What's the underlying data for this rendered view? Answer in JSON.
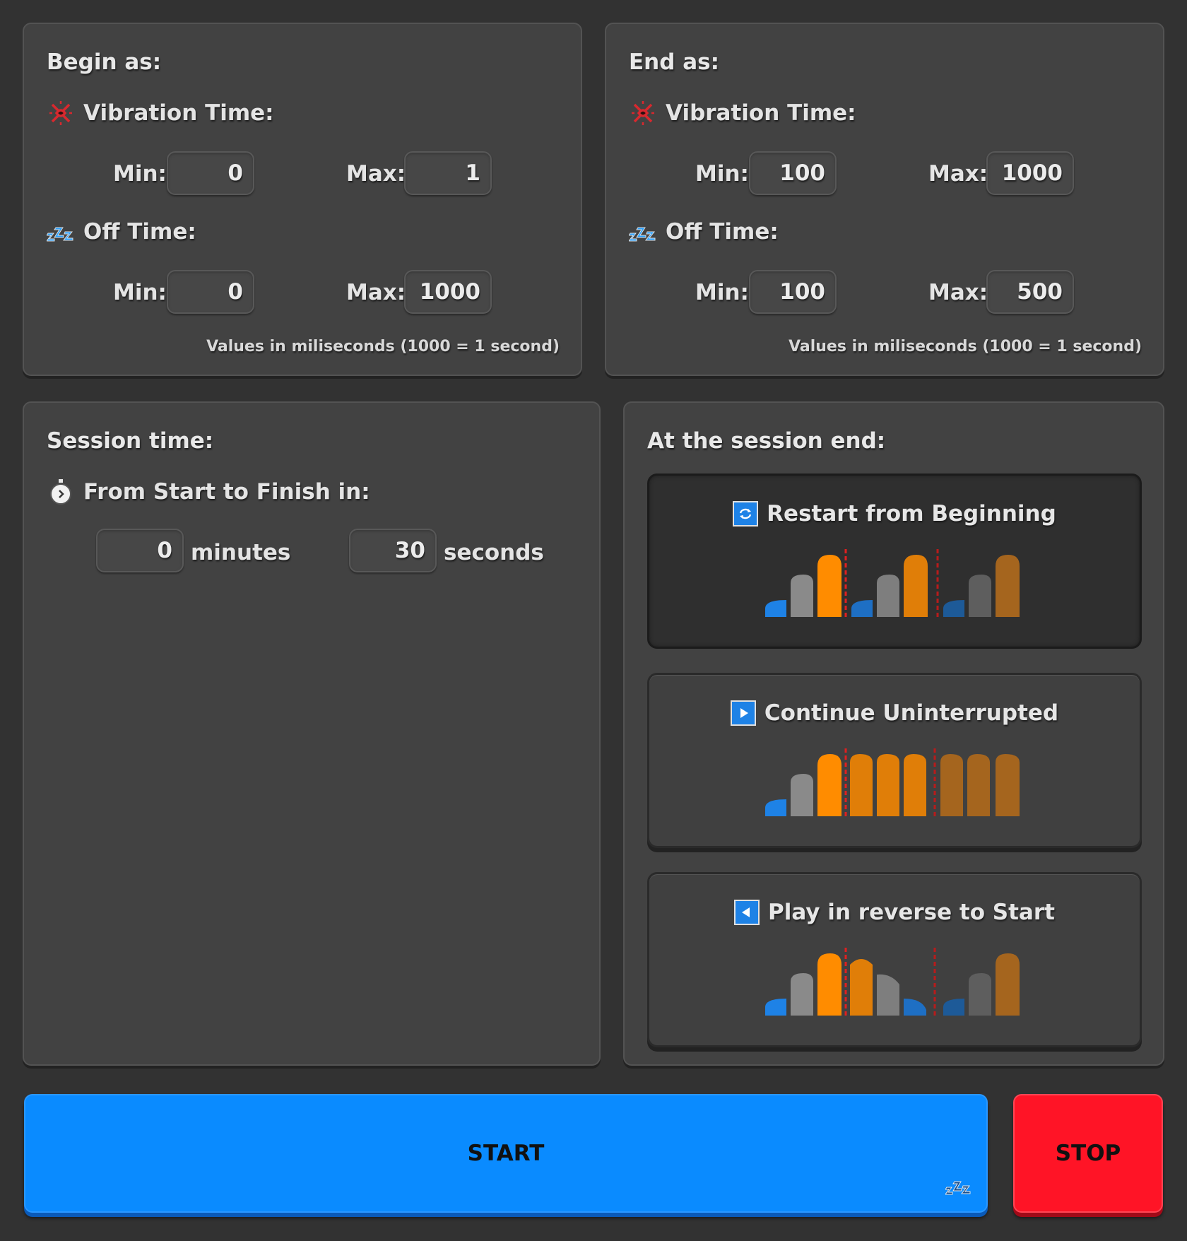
{
  "begin": {
    "title": "Begin as:",
    "vibration_label": "Vibration Time:",
    "off_label": "Off Time:",
    "min_label": "Min:",
    "max_label": "Max:",
    "vibration_min": "0",
    "vibration_max": "1",
    "off_min": "0",
    "off_max": "1000",
    "note": "Values in miliseconds (1000 = 1 second)"
  },
  "end": {
    "title": "End as:",
    "vibration_label": "Vibration Time:",
    "off_label": "Off Time:",
    "min_label": "Min:",
    "max_label": "Max:",
    "vibration_min": "100",
    "vibration_max": "1000",
    "off_min": "100",
    "off_max": "500",
    "note": "Values in miliseconds (1000 = 1 second)"
  },
  "session": {
    "title": "Session time:",
    "subtitle": "From Start to Finish in:",
    "minutes_value": "0",
    "minutes_label": "minutes",
    "seconds_value": "30",
    "seconds_label": "seconds"
  },
  "session_end": {
    "title": "At the session end:",
    "options": [
      {
        "label": "Restart from Beginning",
        "icon": "repeat-icon",
        "selected": true
      },
      {
        "label": "Continue Uninterrupted",
        "icon": "play-icon",
        "selected": false
      },
      {
        "label": "Play in reverse to Start",
        "icon": "reverse-icon",
        "selected": false
      }
    ]
  },
  "buttons": {
    "start": "START",
    "stop": "STOP"
  },
  "colors": {
    "background": "#323232",
    "panel": "#424242",
    "start": "#0a8bff",
    "stop": "#ff1426",
    "accent_blue": "#1e82e6",
    "orange": "#ff8c00"
  }
}
